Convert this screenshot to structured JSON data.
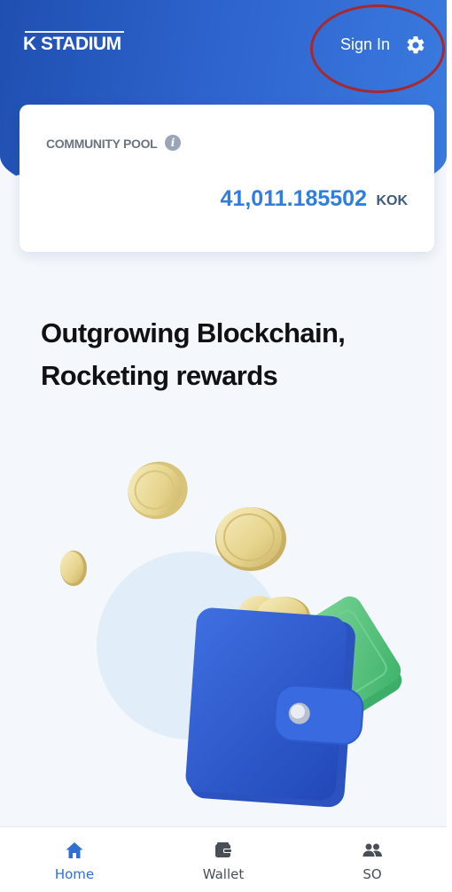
{
  "header": {
    "logo_text": "K STADIUM",
    "sign_in_label": "Sign In",
    "settings_icon": "gear-icon"
  },
  "community_pool": {
    "label": "COMMUNITY POOL",
    "info_icon": "info-icon",
    "value": "41,011.185502",
    "unit": "KOK"
  },
  "headline": {
    "line1": "Outgrowing Blockchain,",
    "line2": "Rocketing rewards"
  },
  "bottom_nav": {
    "items": [
      {
        "label": "Home",
        "icon": "home-icon",
        "active": true
      },
      {
        "label": "Wallet",
        "icon": "wallet-icon",
        "active": false
      },
      {
        "label": "SO",
        "icon": "people-icon",
        "active": false
      }
    ]
  },
  "colors": {
    "header_gradient_start": "#1f4fb0",
    "header_gradient_end": "#3b7be0",
    "accent_blue": "#2f7de1",
    "annotation_red": "#a8282b",
    "active_nav": "#2f6fd3"
  }
}
